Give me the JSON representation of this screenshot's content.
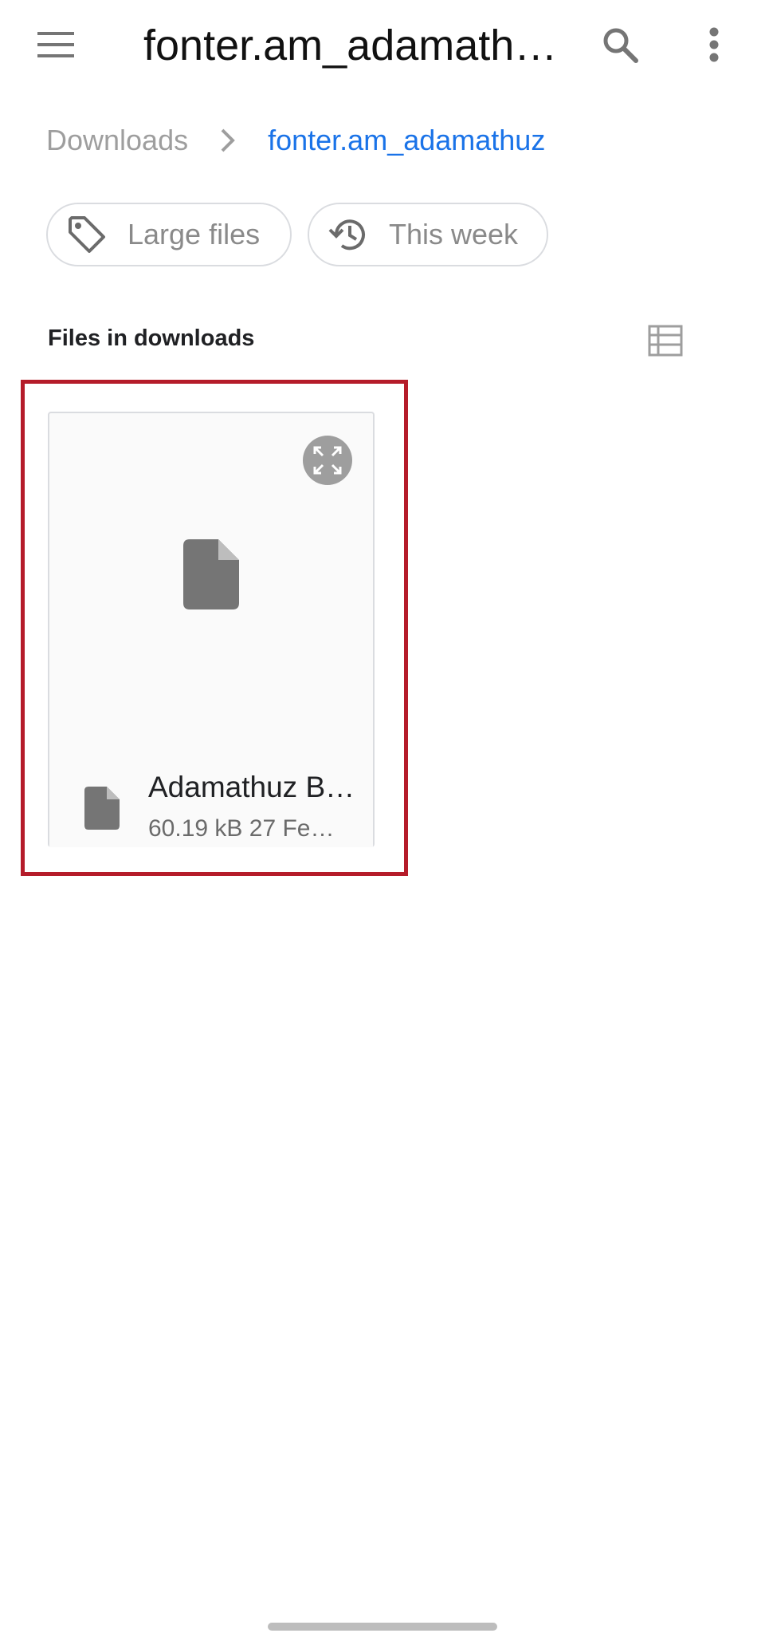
{
  "appbar": {
    "title": "fonter.am_adamath…",
    "menu_icon": "hamburger-menu-icon",
    "search_icon": "search-icon",
    "more_icon": "more-vert-icon"
  },
  "breadcrumb": {
    "root": "Downloads",
    "current": "fonter.am_adamathuz"
  },
  "chips": {
    "large_files": "Large files",
    "this_week": "This week"
  },
  "section": {
    "title": "Files in downloads",
    "view_icon": "list-view-icon"
  },
  "files": [
    {
      "name": "Adamathuz B…",
      "meta": "60.19 kB 27 Fe…"
    }
  ],
  "colors": {
    "accent": "#1a73e8",
    "highlight": "#b51c2a",
    "icon_gray": "#757575"
  }
}
